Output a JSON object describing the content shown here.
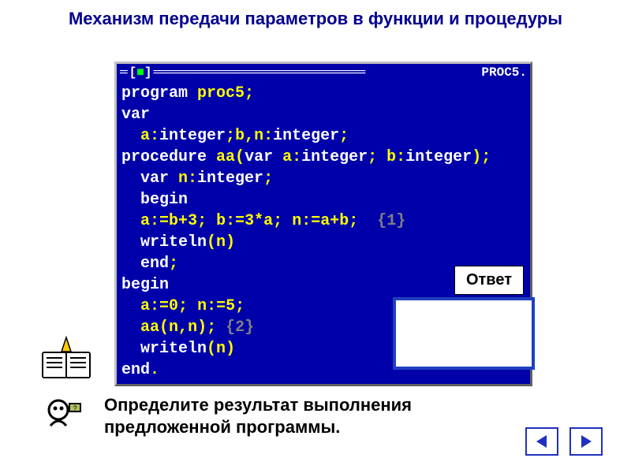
{
  "title": "Механизм передачи параметров в функции и процедуры",
  "ide": {
    "filename": "PROC5.",
    "close_glyph": "■",
    "code_lines": [
      {
        "tokens": [
          {
            "t": "program ",
            "c": "kw"
          },
          {
            "t": "proc5",
            "c": "ident"
          },
          {
            "t": ";",
            "c": "punct"
          }
        ]
      },
      {
        "tokens": [
          {
            "t": "var",
            "c": "kw"
          }
        ]
      },
      {
        "tokens": [
          {
            "t": "  a",
            "c": "ident"
          },
          {
            "t": ":",
            "c": "punct"
          },
          {
            "t": "integer",
            "c": "kw"
          },
          {
            "t": ";",
            "c": "punct"
          },
          {
            "t": "b",
            "c": "ident"
          },
          {
            "t": ",",
            "c": "punct"
          },
          {
            "t": "n",
            "c": "ident"
          },
          {
            "t": ":",
            "c": "punct"
          },
          {
            "t": "integer",
            "c": "kw"
          },
          {
            "t": ";",
            "c": "punct"
          }
        ]
      },
      {
        "tokens": [
          {
            "t": "procedure ",
            "c": "kw"
          },
          {
            "t": "aa",
            "c": "ident"
          },
          {
            "t": "(",
            "c": "punct"
          },
          {
            "t": "var ",
            "c": "kw"
          },
          {
            "t": "a",
            "c": "ident"
          },
          {
            "t": ":",
            "c": "punct"
          },
          {
            "t": "integer",
            "c": "kw"
          },
          {
            "t": "; ",
            "c": "punct"
          },
          {
            "t": "b",
            "c": "ident"
          },
          {
            "t": ":",
            "c": "punct"
          },
          {
            "t": "integer",
            "c": "kw"
          },
          {
            "t": ");",
            "c": "punct"
          }
        ]
      },
      {
        "tokens": [
          {
            "t": "  var ",
            "c": "kw"
          },
          {
            "t": "n",
            "c": "ident"
          },
          {
            "t": ":",
            "c": "punct"
          },
          {
            "t": "integer",
            "c": "kw"
          },
          {
            "t": ";",
            "c": "punct"
          }
        ]
      },
      {
        "tokens": [
          {
            "t": "  begin",
            "c": "kw"
          }
        ]
      },
      {
        "tokens": [
          {
            "t": "  a",
            "c": "ident"
          },
          {
            "t": ":=",
            "c": "punct"
          },
          {
            "t": "b",
            "c": "ident"
          },
          {
            "t": "+",
            "c": "punct"
          },
          {
            "t": "3",
            "c": "num"
          },
          {
            "t": "; ",
            "c": "punct"
          },
          {
            "t": "b",
            "c": "ident"
          },
          {
            "t": ":=",
            "c": "punct"
          },
          {
            "t": "3",
            "c": "num"
          },
          {
            "t": "*",
            "c": "punct"
          },
          {
            "t": "a",
            "c": "ident"
          },
          {
            "t": "; ",
            "c": "punct"
          },
          {
            "t": "n",
            "c": "ident"
          },
          {
            "t": ":=",
            "c": "punct"
          },
          {
            "t": "a",
            "c": "ident"
          },
          {
            "t": "+",
            "c": "punct"
          },
          {
            "t": "b",
            "c": "ident"
          },
          {
            "t": ";  ",
            "c": "punct"
          },
          {
            "t": "{1}",
            "c": "comment"
          }
        ]
      },
      {
        "tokens": [
          {
            "t": "  writeln",
            "c": "kw"
          },
          {
            "t": "(",
            "c": "punct"
          },
          {
            "t": "n",
            "c": "ident"
          },
          {
            "t": ")",
            "c": "punct"
          }
        ]
      },
      {
        "tokens": [
          {
            "t": "  end",
            "c": "kw"
          },
          {
            "t": ";",
            "c": "punct"
          }
        ]
      },
      {
        "tokens": [
          {
            "t": "begin",
            "c": "kw"
          }
        ]
      },
      {
        "tokens": [
          {
            "t": "  a",
            "c": "ident"
          },
          {
            "t": ":=",
            "c": "punct"
          },
          {
            "t": "0",
            "c": "num"
          },
          {
            "t": "; ",
            "c": "punct"
          },
          {
            "t": "n",
            "c": "ident"
          },
          {
            "t": ":=",
            "c": "punct"
          },
          {
            "t": "5",
            "c": "num"
          },
          {
            "t": ";",
            "c": "punct"
          }
        ]
      },
      {
        "tokens": [
          {
            "t": "  aa",
            "c": "ident"
          },
          {
            "t": "(",
            "c": "punct"
          },
          {
            "t": "n",
            "c": "ident"
          },
          {
            "t": ",",
            "c": "punct"
          },
          {
            "t": "n",
            "c": "ident"
          },
          {
            "t": "); ",
            "c": "punct"
          },
          {
            "t": "{2}",
            "c": "comment"
          }
        ]
      },
      {
        "tokens": [
          {
            "t": "  writeln",
            "c": "kw"
          },
          {
            "t": "(",
            "c": "punct"
          },
          {
            "t": "n",
            "c": "ident"
          },
          {
            "t": ")",
            "c": "punct"
          }
        ]
      },
      {
        "tokens": [
          {
            "t": "end",
            "c": "kw"
          },
          {
            "t": ".",
            "c": "punct"
          }
        ]
      }
    ]
  },
  "answer_label": "Ответ",
  "bottom_text_line1": "Определите результат выполнения",
  "bottom_text_line2": "предложенной программы.",
  "icons": {
    "book": "book-icon",
    "thinker": "thinker-icon",
    "prev": "prev-arrow-icon",
    "next": "next-arrow-icon"
  }
}
